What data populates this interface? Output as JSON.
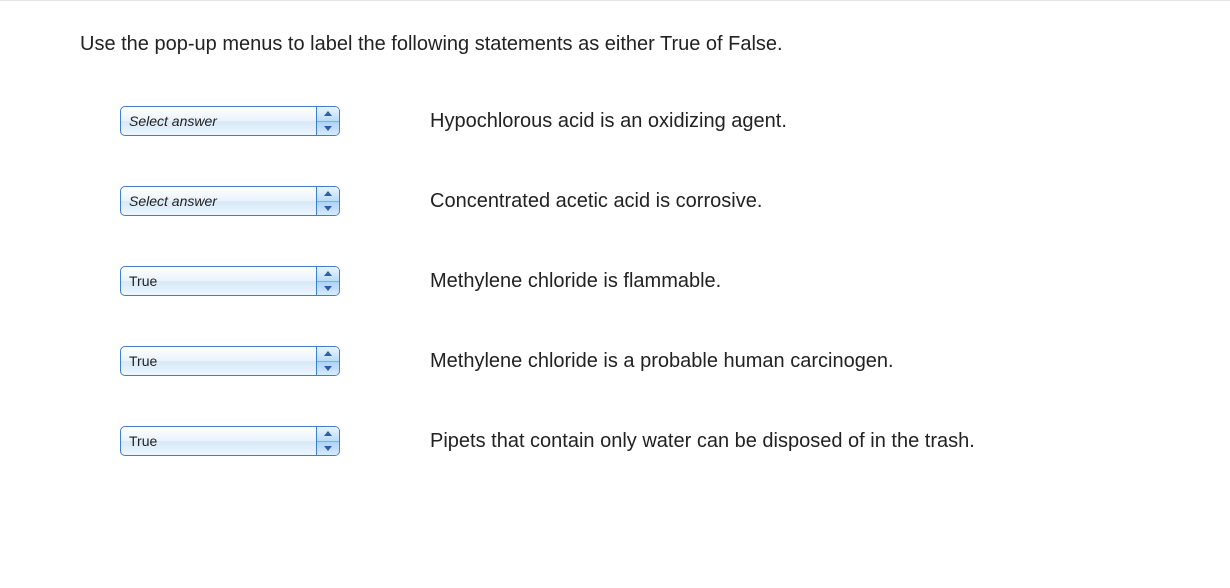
{
  "instruction": "Use the pop-up menus to label the following statements as either True of False.",
  "placeholder": "Select answer",
  "rows": [
    {
      "value": "Select answer",
      "is_placeholder": true,
      "statement": "Hypochlorous acid is an oxidizing agent."
    },
    {
      "value": "Select answer",
      "is_placeholder": true,
      "statement": "Concentrated acetic acid is corrosive."
    },
    {
      "value": "True",
      "is_placeholder": false,
      "statement": "Methylene chloride is flammable."
    },
    {
      "value": "True",
      "is_placeholder": false,
      "statement": "Methylene chloride is a probable human carcinogen."
    },
    {
      "value": "True",
      "is_placeholder": false,
      "statement": "Pipets that contain only water can be disposed of in the trash."
    }
  ]
}
